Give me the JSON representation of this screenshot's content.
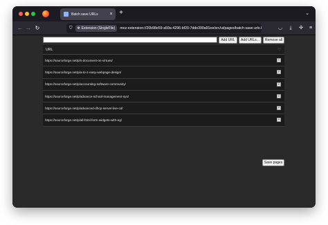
{
  "browser": {
    "tab_title": "Batch save URLs",
    "new_tab_symbol": "+",
    "close_symbol": "×",
    "tab_list_symbol": "⌄",
    "identity_chip": "Extension (SingleFile)",
    "url": "moz-extension://20b98e59-a59a-4296-bf20-7dde390a91ee/src/ui/pages/batch-save-urls.html",
    "icons": [
      "back-icon",
      "forward-icon",
      "reload-icon",
      "shield-icon",
      "puzzle-icon",
      "pocket-icon",
      "download-icon",
      "extensions-icon",
      "menu-icon"
    ]
  },
  "toolbar": {
    "input_value": "",
    "add_url_label": "Add URL",
    "add_urls_label": "Add URLs...",
    "remove_all_label": "Remove all"
  },
  "table": {
    "column_header": "URL",
    "remove_symbol": "✕",
    "rows": [
      "https://sourceforge.net/p/s-document-on-virtues/",
      "https://sourceforge.net/p/a-to-z-easy-webpage-design/",
      "https://sourceforge.net/p/accounting-software-community/",
      "https://sourceforge.net/p/advance-school-management-sys/",
      "https://sourceforge.net/p/advanced-dhcp-server-live-cd/",
      "https://sourceforge.net/p/all-html-form-widgets-with-eg/"
    ]
  },
  "footer": {
    "save_pages_label": "Save pages"
  }
}
